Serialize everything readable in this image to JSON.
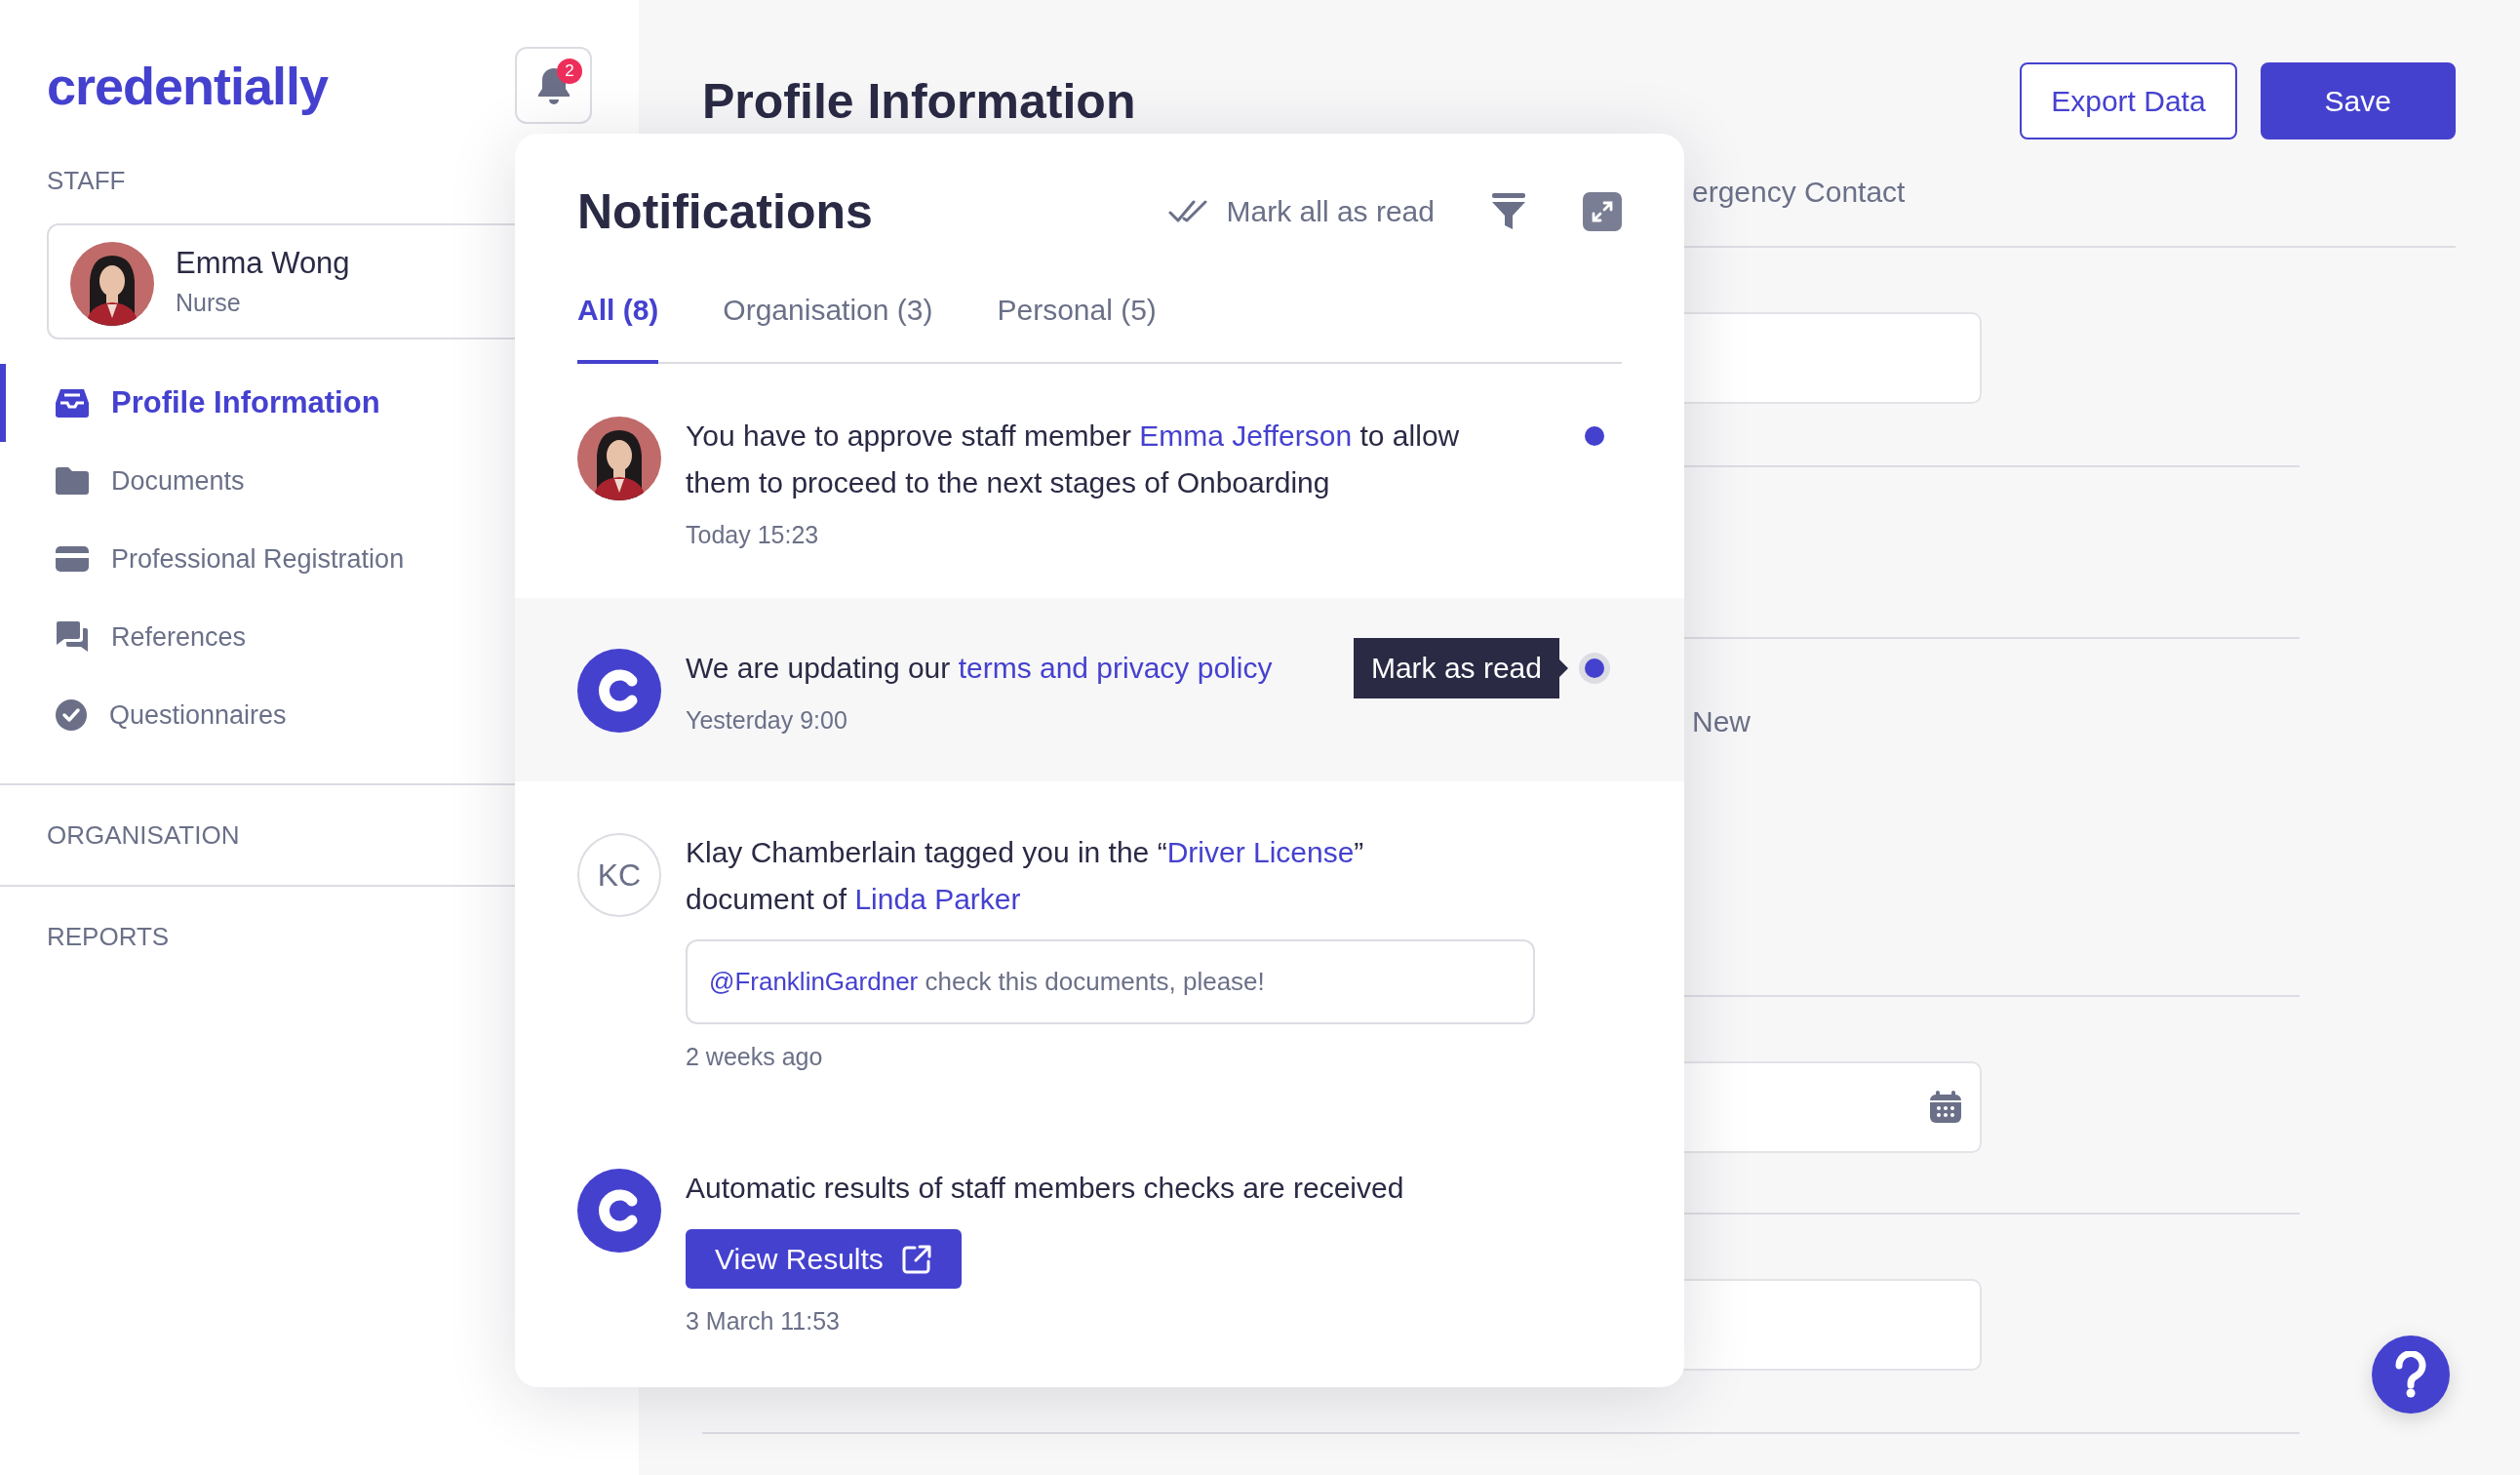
{
  "sidebar": {
    "logo": "credentially",
    "bell_badge": "2",
    "staff_heading": "STAFF",
    "staff": {
      "name": "Emma Wong",
      "role": "Nurse",
      "avatar": {
        "kind": "picture"
      }
    },
    "nav": [
      {
        "label": "Profile Information",
        "selected": true
      },
      {
        "label": "Documents",
        "selected": false
      },
      {
        "label": "Professional Registration",
        "selected": false
      },
      {
        "label": "References",
        "selected": false
      },
      {
        "label": "Questionnaires",
        "selected": false
      }
    ],
    "sections": [
      "ORGANISATION",
      "REPORTS"
    ]
  },
  "main": {
    "title": "Profile Information",
    "buttons": [
      {
        "label": "Export Data",
        "kind": "outline"
      },
      {
        "label": "Save",
        "kind": "primary"
      }
    ],
    "tab": "ergency Contact",
    "sections": [
      {
        "kind": "field"
      },
      {
        "kind": "blank"
      },
      {
        "kind": "label",
        "text": "New"
      },
      {
        "kind": "date_field"
      },
      {
        "kind": "field"
      }
    ]
  },
  "notifications": {
    "title": "Notifications",
    "mark_all": "Mark all as read",
    "tabs": [
      {
        "label": "All (8)",
        "selected": true
      },
      {
        "label": "Organisation (3)",
        "selected": false
      },
      {
        "label": "Personal (5)",
        "selected": false
      }
    ],
    "items": [
      {
        "avatar": {
          "kind": "picture"
        },
        "text": [
          {
            "kind": "plain",
            "text": "You have to approve staff member "
          },
          {
            "kind": "link",
            "text": "Emma Jefferson"
          },
          {
            "kind": "plain",
            "text": " to allow them to proceed to the next stages of Onboarding"
          }
        ],
        "time": "Today 15:23",
        "unread": true
      },
      {
        "avatar": {
          "kind": "logo"
        },
        "text": [
          {
            "kind": "plain",
            "text": "We are updating our "
          },
          {
            "kind": "link",
            "text": "terms and privacy policy"
          }
        ],
        "time": "Yesterday 9:00",
        "unread": true,
        "tooltip": "Mark as read"
      },
      {
        "avatar": {
          "kind": "initials",
          "text": "KC"
        },
        "text": [
          {
            "kind": "plain",
            "text": "Klay Chamberlain tagged you in the “"
          },
          {
            "kind": "link",
            "text": "Driver License"
          },
          {
            "kind": "plain",
            "text": "” document of "
          },
          {
            "kind": "link",
            "text": "Linda Parker"
          }
        ],
        "comment": {
          "mention": "@FranklinGardner",
          "text": " check this documents, please!"
        },
        "time": "2 weeks ago",
        "unread": false
      },
      {
        "avatar": {
          "kind": "logo"
        },
        "text": [
          {
            "kind": "plain",
            "text": "Automatic results of staff members checks are received"
          }
        ],
        "action": "View Results",
        "time": "3 March 11:53",
        "unread": false
      }
    ]
  }
}
